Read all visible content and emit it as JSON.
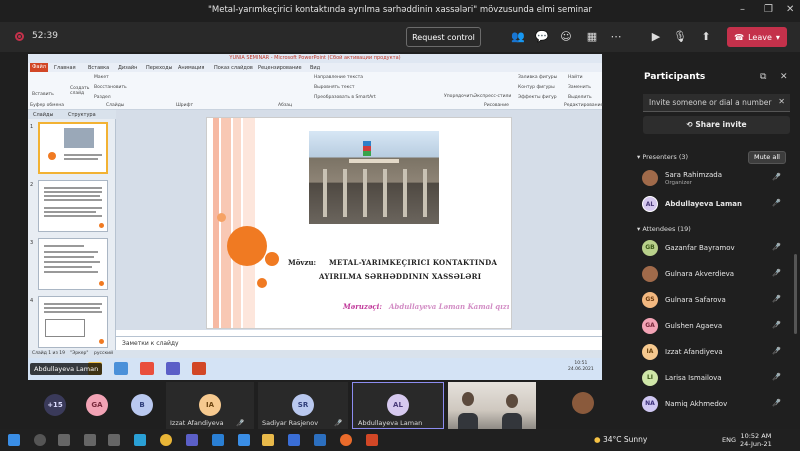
{
  "window": {
    "title": "\"Metal-yarımkeçirici kontaktında ayrılma sərhəddinin xassələri\" mövzusunda elmi seminar",
    "minimize": "–",
    "maximize": "❐",
    "close": "✕"
  },
  "meeting": {
    "timer": "52:39",
    "request_control": "Request control",
    "leave": "Leave"
  },
  "ppt": {
    "title": "YUNIA SEMINAR - Microsoft PowerPoint (Сбой активации продукта)",
    "file_tab": "Файл",
    "tabs": [
      "Главная",
      "Вставка",
      "Дизайн",
      "Переходы",
      "Анимация",
      "Показ слайдов",
      "Рецензирование",
      "Вид"
    ],
    "ribbon": {
      "paste": "Вставить",
      "layout": "Макет",
      "reset": "Восстановить",
      "create_slide": "Создать слайд",
      "section": "Раздел",
      "clipboard": "Буфер обмена",
      "slides": "Слайды",
      "font": "Шрифт",
      "paragraph": "Абзац",
      "text_direction": "Направление текста",
      "align_text": "Выровнять текст",
      "smartart": "Преобразовать в SmartArt",
      "arrange": "Упорядочить",
      "quick_styles": "Экспресс-стили",
      "shape_fill": "Заливка фигуры",
      "shape_outline": "Контур фигуры",
      "shape_effects": "Эффекты фигур",
      "drawing": "Рисование",
      "find": "Найти",
      "replace": "Заменить",
      "select": "Выделить",
      "editing": "Редактирование"
    },
    "pane_tabs": [
      "Слайды",
      "Структура"
    ],
    "slide": {
      "topic_label": "Mövzu:",
      "topic_line1": "METAL-YARIMKEÇIRICI KONTAKTINDA",
      "topic_line2": "AYIRILMA SƏRHƏDDININ XASSƏLƏRI",
      "speaker_label": "Məruzəçi:",
      "speaker_name": "Abdullayeva Ləman Kamal qızı"
    },
    "notes": "Заметки к слайду",
    "status": {
      "slide_count": "Слайд 1 из 19",
      "theme": "\"Эркер\"",
      "lang": "русский"
    },
    "presenter_tag": "Abdullayeva Laman",
    "os_clock": {
      "time": "10:51",
      "date": "24.06.2021"
    }
  },
  "participants": {
    "heading": "Participants",
    "invite_placeholder": "Invite someone or dial a number",
    "share_invite": "Share invite",
    "presenters_label": "Presenters (3)",
    "mute_all": "Mute all",
    "presenters": [
      {
        "name": "Sara Rahimzada",
        "role": "Organizer",
        "initials": ""
      },
      {
        "name": "Abdullayeva Laman",
        "role": "",
        "initials": "AL"
      }
    ],
    "attendees_label": "Attendees (19)",
    "attendees": [
      {
        "name": "Gazanfar Bayramov",
        "initials": "GB",
        "color": "#b8d08a"
      },
      {
        "name": "Gulnara Akverdieva",
        "initials": "",
        "color": "#a06a4a"
      },
      {
        "name": "Gulnara Safarova",
        "initials": "GS",
        "color": "#f2b880"
      },
      {
        "name": "Gulshen Agaeva",
        "initials": "GA",
        "color": "#f2a3b5"
      },
      {
        "name": "Izzat Afandiyeva",
        "initials": "IA",
        "color": "#f6c98f"
      },
      {
        "name": "Larisa Ismailova",
        "initials": "LI",
        "color": "#cfe6a8"
      },
      {
        "name": "Namiq Akhmedov",
        "initials": "NA",
        "color": "#cfc7f2"
      }
    ]
  },
  "gallery": {
    "overflow": "+15",
    "circles": [
      {
        "initials": "GA",
        "color": "#f2a3b5"
      },
      {
        "initials": "B",
        "color": "#b9c8ef"
      }
    ],
    "tiles": [
      {
        "initials": "IA",
        "name": "Izzat Afandiyeva",
        "color": "#f6c98f"
      },
      {
        "initials": "SR",
        "name": "Sadiyar Rasjenov",
        "color": "#b9c8ef"
      },
      {
        "initials": "AL",
        "name": "Abdullayeva Laman",
        "color": "#d6c9ef"
      }
    ]
  },
  "taskbar": {
    "weather": "34°C  Sunny",
    "lang": "ENG",
    "time": "10:52 AM",
    "date": "24-Jun-21"
  }
}
